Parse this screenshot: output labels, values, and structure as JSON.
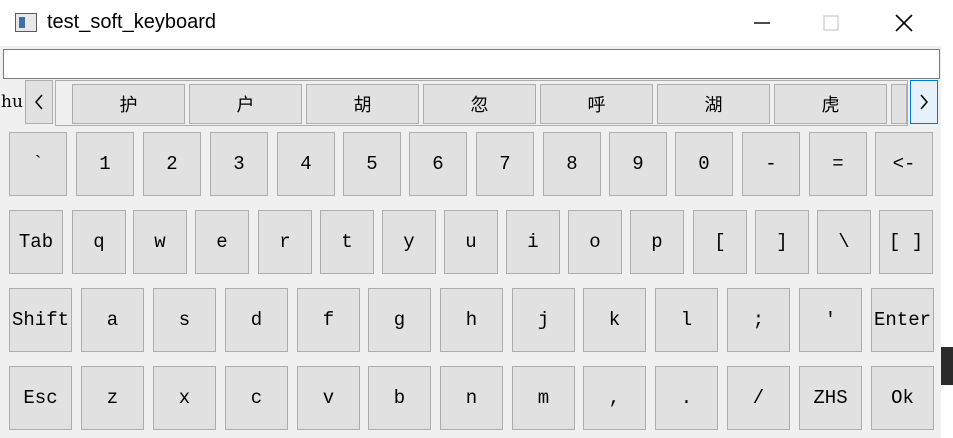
{
  "window": {
    "title": "test_soft_keyboard",
    "icons": {
      "app": "app-window-icon",
      "minimize": "minimize-icon",
      "maximize": "maximize-icon",
      "close": "close-icon"
    }
  },
  "input": {
    "value": ""
  },
  "candidates": {
    "pinyin": "hu",
    "prev_icon": "chevron-left-icon",
    "next_icon": "chevron-right-icon",
    "items": [
      "护",
      "户",
      "胡",
      "忽",
      "呼",
      "湖",
      "虎"
    ]
  },
  "rows": [
    [
      "`",
      "1",
      "2",
      "3",
      "4",
      "5",
      "6",
      "7",
      "8",
      "9",
      "0",
      "-",
      "=",
      "<-"
    ],
    [
      "Tab",
      "q",
      "w",
      "e",
      "r",
      "t",
      "y",
      "u",
      "i",
      "o",
      "p",
      "[",
      "]",
      "\\",
      "[ ]"
    ],
    [
      "Shift",
      "a",
      "s",
      "d",
      "f",
      "g",
      "h",
      "j",
      "k",
      "l",
      ";",
      "'",
      "Enter"
    ],
    [
      "Esc",
      "z",
      "x",
      "c",
      "v",
      "b",
      "n",
      "m",
      ",",
      ".",
      "/",
      "ZHS",
      "Ok"
    ]
  ]
}
